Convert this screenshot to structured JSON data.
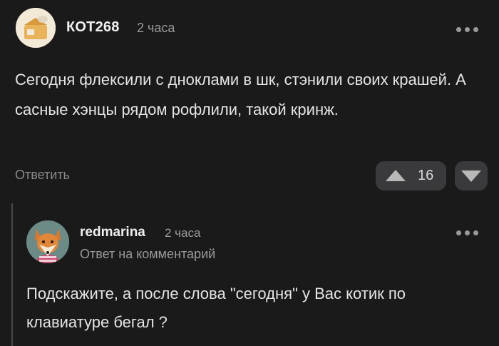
{
  "comment": {
    "author": "КОТ268",
    "time": "2 часа",
    "text": "Сегодня флексили с дноклами в шк, стэнили своих крашей. А сасные хэнцы рядом рофлили, такой кринж.",
    "reply_label": "Ответить",
    "rating": "16"
  },
  "reply": {
    "author": "redmarina",
    "time": "2 часа",
    "reply_to": "Ответ на комментарий",
    "text": "Подскажите, а после слова \"сегодня\" у Вас котик по клавиатуре бегал ?"
  },
  "icons": {
    "more": "more-dots-icon",
    "upvote": "upvote-triangle-icon",
    "downvote": "downvote-triangle-icon"
  },
  "colors": {
    "background": "#1a1a1b",
    "vote_button": "#3a3a3c",
    "muted_text": "#9a9a9a"
  }
}
